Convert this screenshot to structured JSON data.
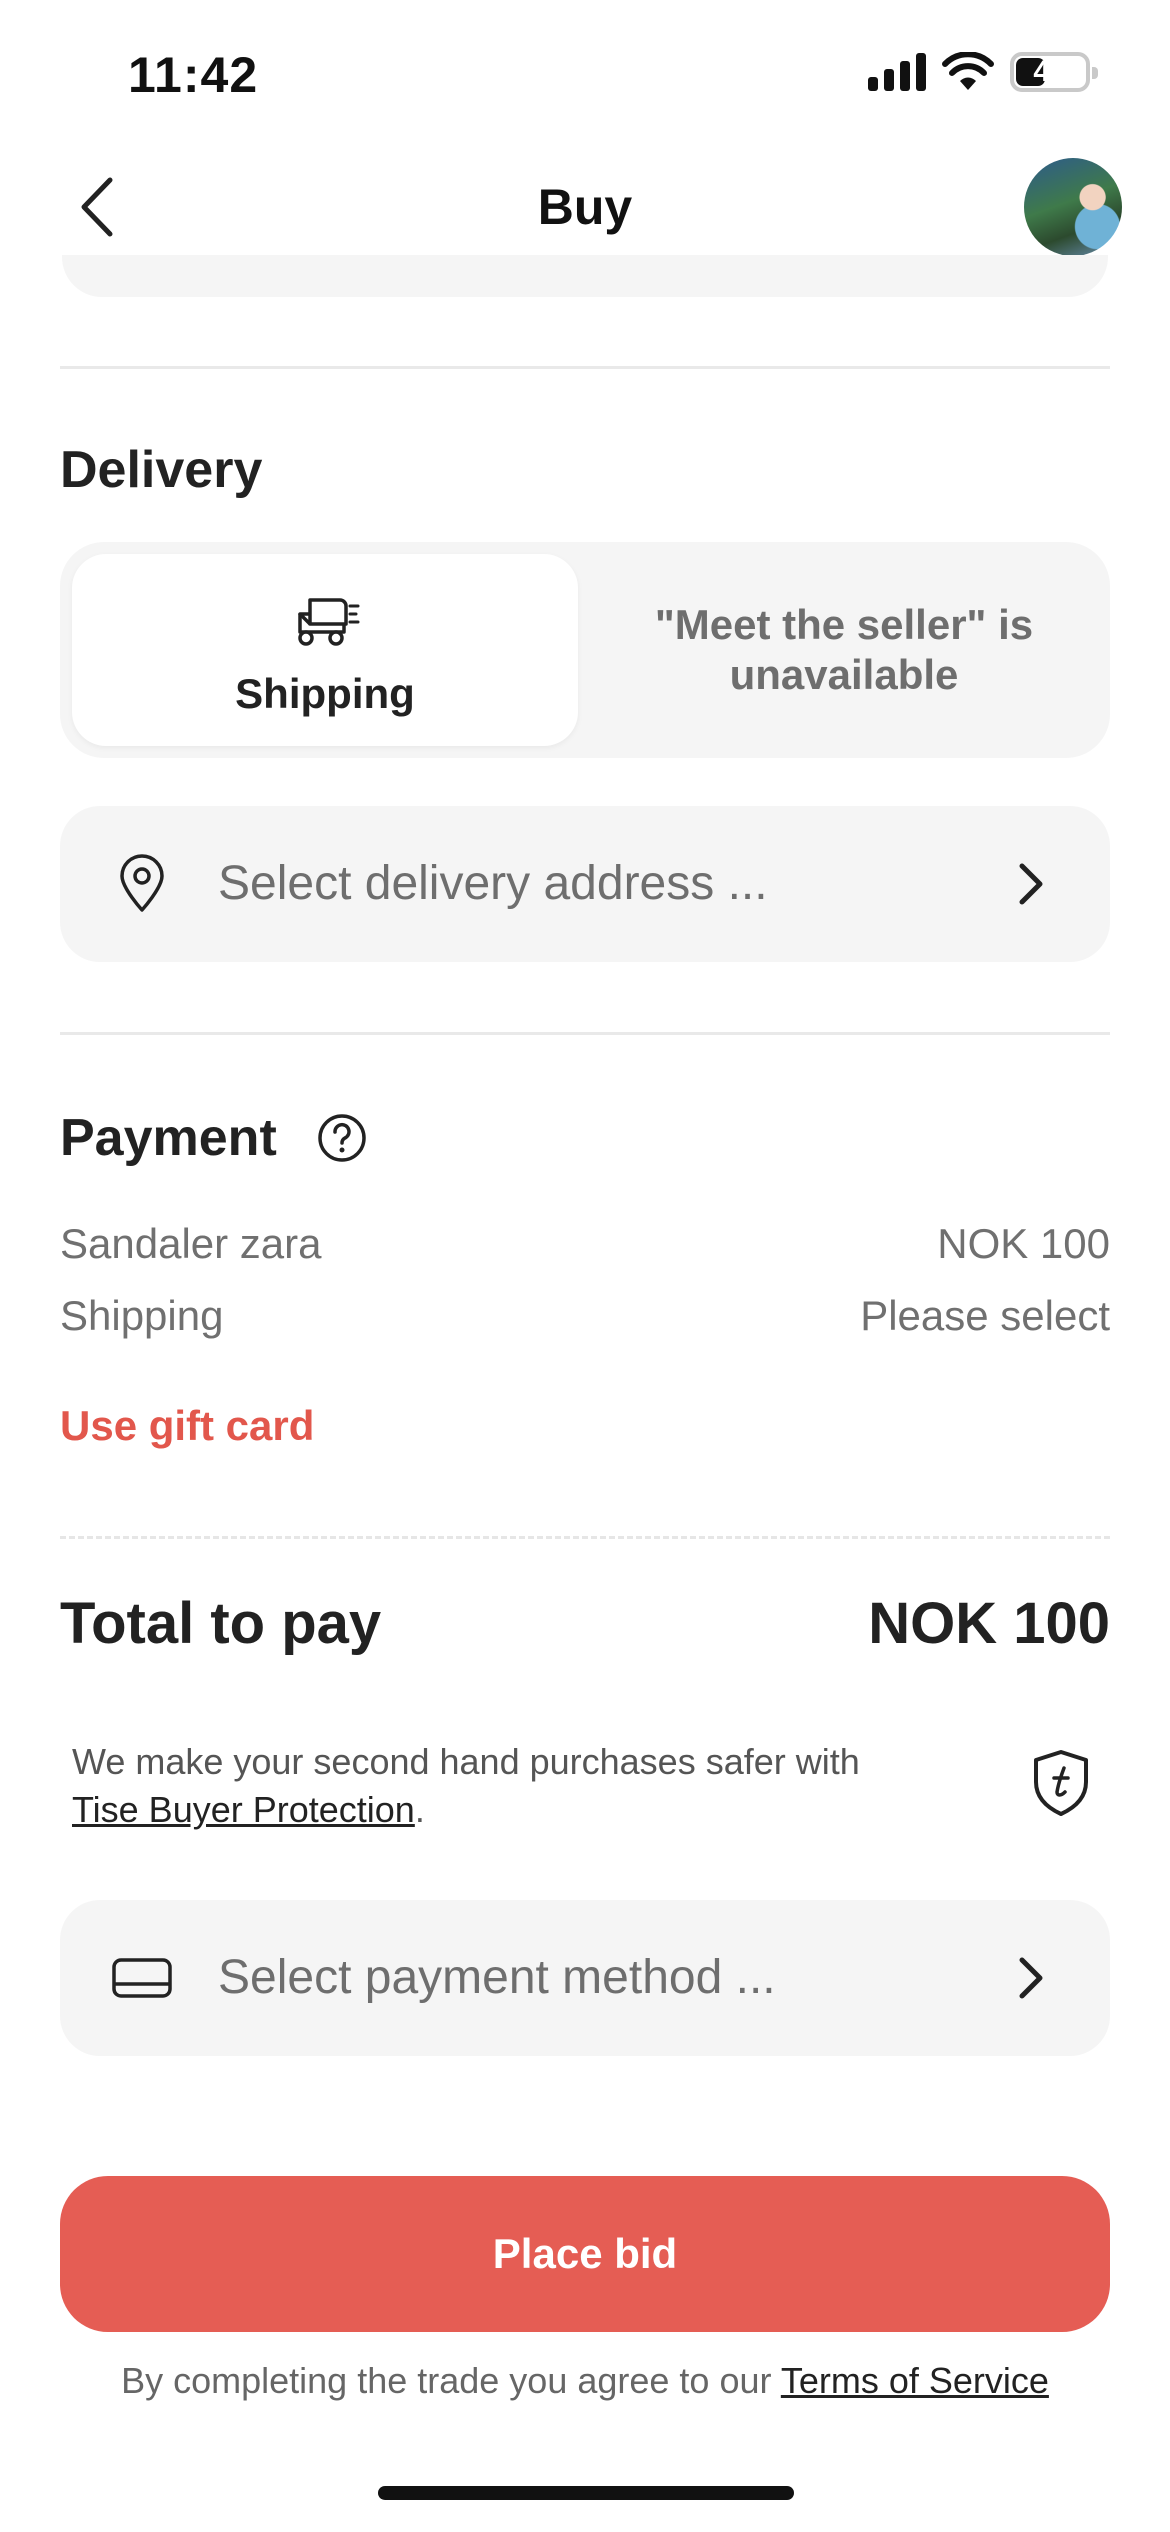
{
  "status_bar": {
    "time": "11:42",
    "battery": "40"
  },
  "header": {
    "title": "Buy"
  },
  "delivery": {
    "title": "Delivery",
    "option_shipping": "Shipping",
    "option_meet_seller": "\"Meet the seller\" is unavailable",
    "address_placeholder": "Select delivery address ..."
  },
  "payment": {
    "title": "Payment",
    "item_label": "Sandaler zara",
    "item_price": "NOK 100",
    "shipping_label": "Shipping",
    "shipping_value": "Please select",
    "gift_card": "Use gift card"
  },
  "total": {
    "label": "Total to pay",
    "value": "NOK 100"
  },
  "protection": {
    "text": "We make your second hand purchases safer with",
    "link": "Tise Buyer Protection",
    "suffix": "."
  },
  "payment_method": {
    "placeholder": "Select payment method ..."
  },
  "actions": {
    "place_bid": "Place bid"
  },
  "terms": {
    "text": "By completing the trade you agree to our",
    "link": "Terms of Service"
  },
  "colors": {
    "accent": "#e55d54",
    "card_bg": "#f5f5f5"
  }
}
